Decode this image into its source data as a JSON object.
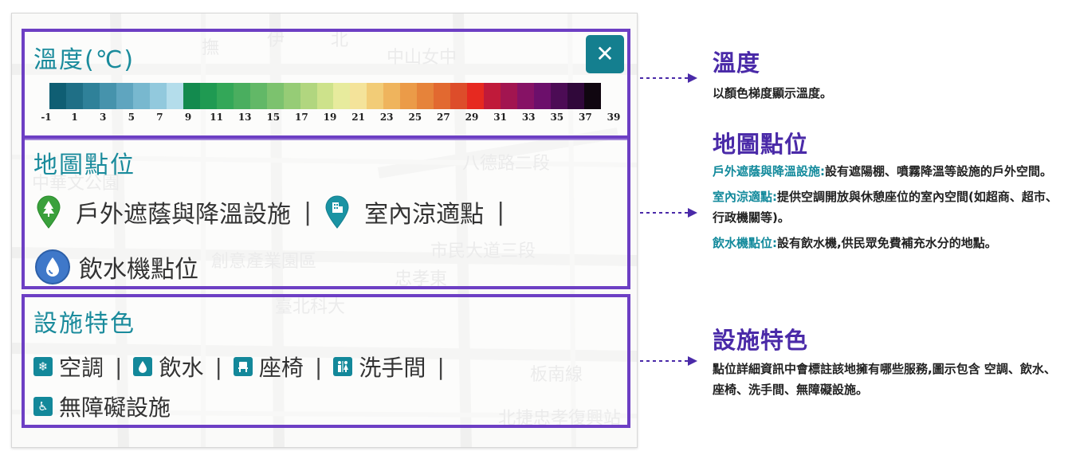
{
  "panel": {
    "temperature": {
      "title": "溫度(℃)",
      "close_icon": "✕",
      "scale_colors": [
        "#0f5e73",
        "#1f6f86",
        "#2f8199",
        "#4693ac",
        "#5fa5bf",
        "#78b8cf",
        "#92c9dd",
        "#b4ddeb",
        "#138a4e",
        "#1f9a52",
        "#33a758",
        "#4aae5f",
        "#62b867",
        "#7cc26e",
        "#96cc76",
        "#b1d67f",
        "#cde28b",
        "#e7eb9d",
        "#f4e39a",
        "#f2cc77",
        "#efb45d",
        "#eb9b48",
        "#e6833a",
        "#e26930",
        "#dd4d2a",
        "#e62920",
        "#c01a3a",
        "#a21550",
        "#861265",
        "#6c0f6b",
        "#4c0c55",
        "#30083a",
        "#100610"
      ],
      "scale_ticks": [
        "-1",
        "1",
        "3",
        "5",
        "7",
        "9",
        "11",
        "13",
        "15",
        "17",
        "19",
        "21",
        "23",
        "25",
        "27",
        "29",
        "31",
        "33",
        "35",
        "37",
        "39"
      ]
    },
    "locations": {
      "title": "地圖點位",
      "item1": "戶外遮蔭與降溫設施",
      "item2": "室內涼適點",
      "item3": "飲水機點位",
      "sep": "|",
      "icon1": "tree-pin-icon",
      "icon2": "building-pin-icon",
      "icon3": "water-drop-icon"
    },
    "features": {
      "title": "設施特色",
      "aircon": "空調",
      "water": "飲水",
      "bench": "座椅",
      "restroom": "洗手間",
      "accessible": "無障礙設施",
      "sep": "|",
      "aircon_glyph": "❄",
      "accessible_glyph": "♿"
    },
    "map_labels": [
      "撫",
      "遠",
      "伊",
      "通",
      "北",
      "路",
      "中山女中",
      "八德路二段",
      "市民大道三段",
      "忠孝東",
      "臺北科大",
      "中華文公園",
      "創意產業園區",
      "北捷忠孝復興站",
      "板南線",
      "廣",
      "線",
      "計"
    ]
  },
  "annotations": {
    "temperature": {
      "title": "溫度",
      "text": "以顏色梯度顯示溫度。"
    },
    "locations": {
      "title": "地圖點位",
      "p1_label": "戶外遮蔭與降溫設施:",
      "p1_text": "設有遮陽棚、噴霧降溫等設施的戶外空間。",
      "p2_label": "室內涼適點:",
      "p2_text": "提供空調開放與休憩座位的室內空間(如超商、超市、行政機關等)。",
      "p3_label": "飲水機點位:",
      "p3_text": "設有飲水機,供民眾免費補充水分的地點。"
    },
    "features": {
      "title": "設施特色",
      "text": "點位詳細資訊中會標註該地擁有哪些服務,圖示包含 空調、飲水、座椅、洗手間、無障礙設施。"
    }
  },
  "colors": {
    "frame": "#6d3fc4",
    "teal": "#147f8f",
    "title_teal": "#1a8b9c",
    "note_purple": "#4a2aa8"
  }
}
